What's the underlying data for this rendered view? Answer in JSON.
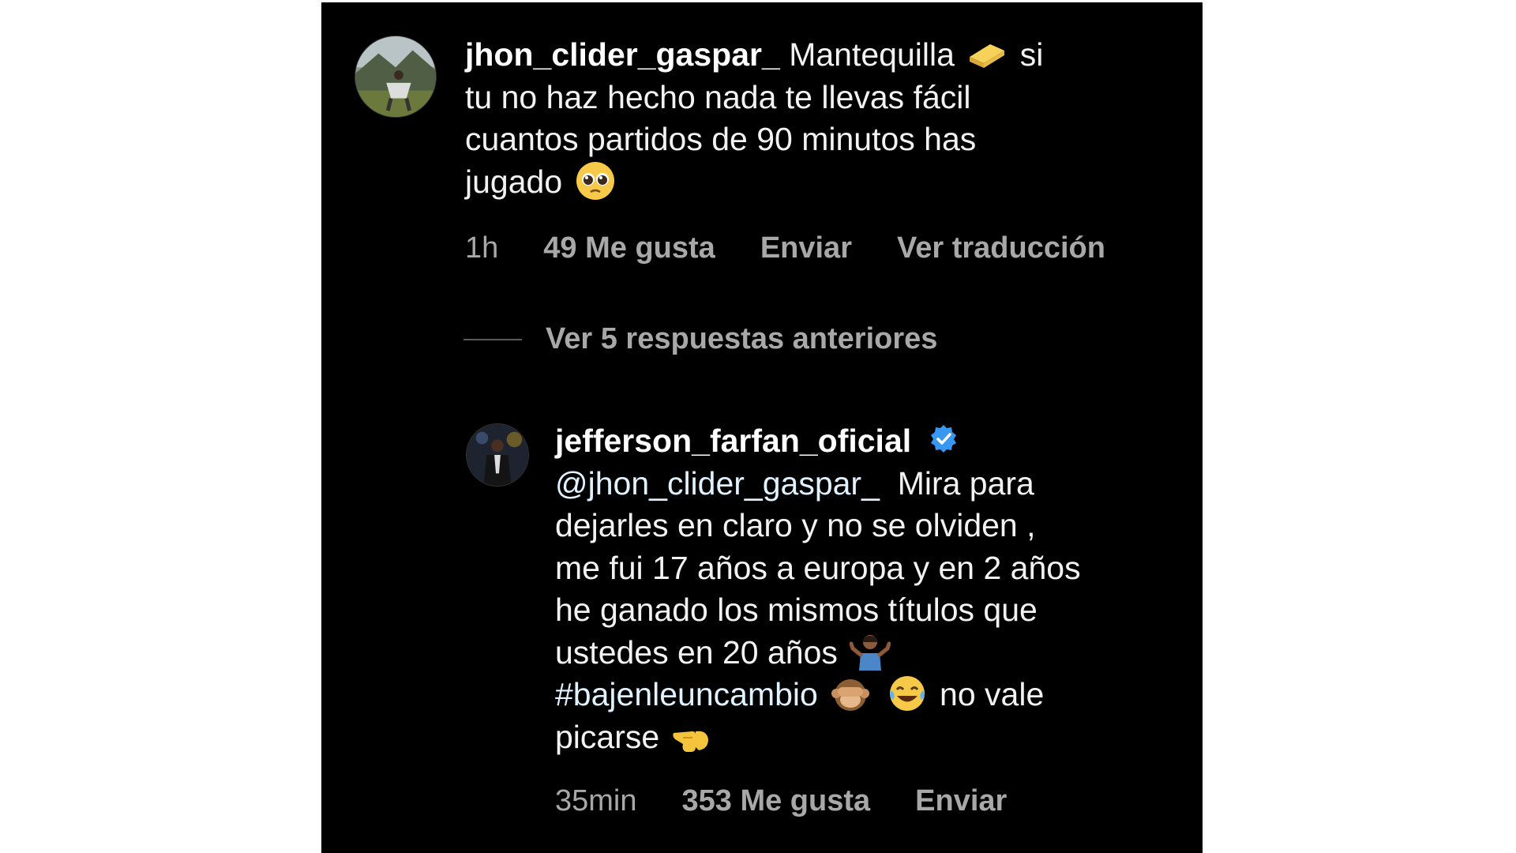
{
  "comment": {
    "username": "jhon_clider_gaspar_",
    "line1_text": "Mantequilla",
    "line1_after_emoji": "si",
    "line2": "tu no haz hecho nada te llevas fácil",
    "line3": "cuantos partidos de 90 minutos has",
    "line4": "jugado",
    "emojis": [
      "butter-bar-emoji",
      "pleading-face-emoji"
    ],
    "time": "1h",
    "likes": "49 Me gusta",
    "send": "Enviar",
    "translate": "Ver traducción"
  },
  "replies_toggle": "Ver 5 respuestas anteriores",
  "reply": {
    "username": "jefferson_farfan_oficial",
    "verified": true,
    "mention": "@jhon_clider_gaspar_",
    "line1_after_mention": "Mira para",
    "line2": "dejarles en claro y no se olviden ,",
    "line3": "me fui 17 años a europa y en 2 años",
    "line4": "he ganado los mismos títulos que",
    "line5": "ustedes en 20 años",
    "hashtag": "#bajenleuncambio",
    "line6_after_emojis": "no vale",
    "line7": "picarse",
    "emojis": [
      "person-shrugging-emoji",
      "see-no-evil-monkey-emoji",
      "tears-of-joy-emoji",
      "pointing-left-emoji"
    ],
    "time": "35min",
    "likes": "353 Me gusta",
    "send": "Enviar"
  },
  "colors": {
    "background": "#000000",
    "text": "#f2f2f2",
    "meta": "#a8a8a8",
    "verified": "#3897f0",
    "link": "#e0f1ff"
  }
}
